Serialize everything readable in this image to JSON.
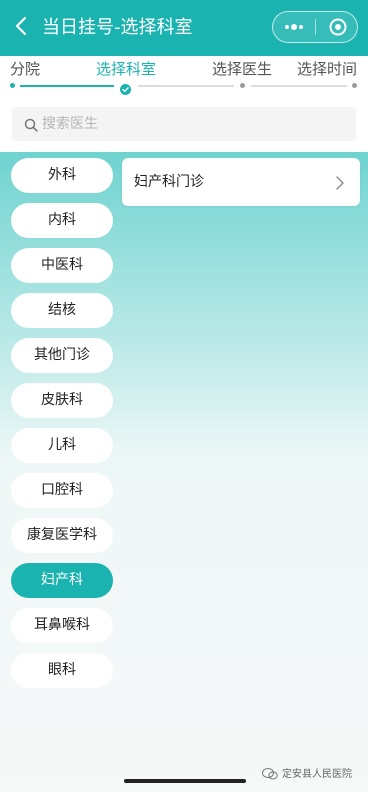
{
  "header": {
    "title": "当日挂号-选择科室"
  },
  "steps": [
    {
      "label": "分院",
      "state": "done"
    },
    {
      "label": "选择科室",
      "state": "active"
    },
    {
      "label": "选择医生",
      "state": "pending"
    },
    {
      "label": "选择时间",
      "state": "pending"
    }
  ],
  "search": {
    "placeholder": "搜索医生",
    "value": ""
  },
  "departments": [
    {
      "label": "外科",
      "selected": false
    },
    {
      "label": "内科",
      "selected": false
    },
    {
      "label": "中医科",
      "selected": false
    },
    {
      "label": "结核",
      "selected": false
    },
    {
      "label": "其他门诊",
      "selected": false
    },
    {
      "label": "皮肤科",
      "selected": false
    },
    {
      "label": "儿科",
      "selected": false
    },
    {
      "label": "口腔科",
      "selected": false
    },
    {
      "label": "康复医学科",
      "selected": false
    },
    {
      "label": "妇产科",
      "selected": true
    },
    {
      "label": "耳鼻喉科",
      "selected": false
    },
    {
      "label": "眼科",
      "selected": false
    }
  ],
  "clinics": [
    {
      "label": "妇产科门诊"
    }
  ],
  "watermark": {
    "text": "定安县人民医院"
  },
  "colors": {
    "accent": "#1bb3b0",
    "pill_text": "#222222",
    "step_inactive": "#555555"
  }
}
